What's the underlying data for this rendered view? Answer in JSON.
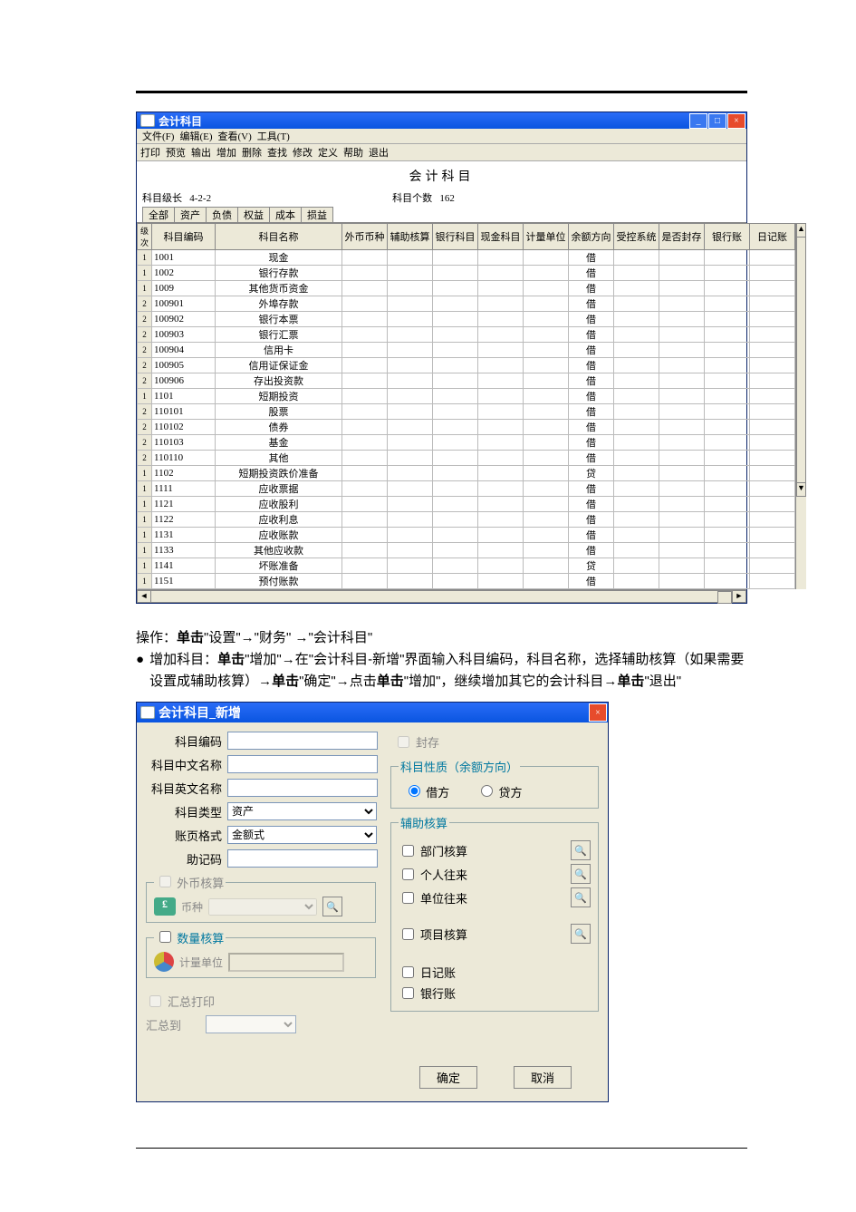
{
  "window1": {
    "title": "会计科目",
    "menus": [
      "文件(F)",
      "编辑(E)",
      "查看(V)",
      "工具(T)"
    ],
    "toolbar": [
      "打印",
      "预览",
      "输出",
      "增加",
      "删除",
      "查找",
      "修改",
      "定义",
      "帮助",
      "退出"
    ],
    "heading": "会计科目",
    "meta": {
      "length_label": "科目级长",
      "length_value": "4-2-2",
      "count_label": "科目个数",
      "count_value": "162"
    },
    "tabs": [
      "全部",
      "资产",
      "负债",
      "权益",
      "成本",
      "损益"
    ],
    "columns": [
      "级次",
      "科目编码",
      "科目名称",
      "外币币种",
      "辅助核算",
      "银行科目",
      "现金科目",
      "计量单位",
      "余额方向",
      "受控系统",
      "是否封存",
      "银行账",
      "日记账"
    ],
    "rows": [
      {
        "lv": "1",
        "code": "1001",
        "name": "现金",
        "dir": "借"
      },
      {
        "lv": "1",
        "code": "1002",
        "name": "银行存款",
        "dir": "借"
      },
      {
        "lv": "1",
        "code": "1009",
        "name": "其他货币资金",
        "dir": "借"
      },
      {
        "lv": "2",
        "code": "100901",
        "name": "外埠存款",
        "dir": "借"
      },
      {
        "lv": "2",
        "code": "100902",
        "name": "银行本票",
        "dir": "借"
      },
      {
        "lv": "2",
        "code": "100903",
        "name": "银行汇票",
        "dir": "借"
      },
      {
        "lv": "2",
        "code": "100904",
        "name": "信用卡",
        "dir": "借"
      },
      {
        "lv": "2",
        "code": "100905",
        "name": "信用证保证金",
        "dir": "借"
      },
      {
        "lv": "2",
        "code": "100906",
        "name": "存出投资款",
        "dir": "借"
      },
      {
        "lv": "1",
        "code": "1101",
        "name": "短期投资",
        "dir": "借"
      },
      {
        "lv": "2",
        "code": "110101",
        "name": "股票",
        "dir": "借"
      },
      {
        "lv": "2",
        "code": "110102",
        "name": "债券",
        "dir": "借"
      },
      {
        "lv": "2",
        "code": "110103",
        "name": "基金",
        "dir": "借"
      },
      {
        "lv": "2",
        "code": "110110",
        "name": "其他",
        "dir": "借"
      },
      {
        "lv": "1",
        "code": "1102",
        "name": "短期投资跌价准备",
        "dir": "贷"
      },
      {
        "lv": "1",
        "code": "1111",
        "name": "应收票据",
        "dir": "借"
      },
      {
        "lv": "1",
        "code": "1121",
        "name": "应收股利",
        "dir": "借"
      },
      {
        "lv": "1",
        "code": "1122",
        "name": "应收利息",
        "dir": "借"
      },
      {
        "lv": "1",
        "code": "1131",
        "name": "应收账款",
        "dir": "借"
      },
      {
        "lv": "1",
        "code": "1133",
        "name": "其他应收款",
        "dir": "借"
      },
      {
        "lv": "1",
        "code": "1141",
        "name": "坏账准备",
        "dir": "贷"
      },
      {
        "lv": "1",
        "code": "1151",
        "name": "预付账款",
        "dir": "借"
      }
    ]
  },
  "instructions": {
    "line1_prefix": "操作：",
    "line1_bold": "单击",
    "line1_rest": "\"设置\"→\"财务\" →\"会计科目\"",
    "bullet_title": "增加科目：",
    "bullet_b1": "单击",
    "bullet_t1": "\"增加\"→在\"会计科目-新增\"界面输入科目编码，科目名称，选择辅助核算（如果需要设置成辅助核算）→",
    "bullet_b2": "单击",
    "bullet_t2": "\"确定\"→点击",
    "bullet_b3": "单击",
    "bullet_t3": "\"增加\"，继续增加其它的会计科目→",
    "bullet_b4": "单击",
    "bullet_t4": "\"退出\""
  },
  "dialog": {
    "title": "会计科目_新增",
    "fields": {
      "code": "科目编码",
      "name_cn": "科目中文名称",
      "name_en": "科目英文名称",
      "type": "科目类型",
      "type_value": "资产",
      "page": "账页格式",
      "page_value": "金额式",
      "mnemonic": "助记码"
    },
    "groups": {
      "fx": "外币核算",
      "fx_currency": "币种",
      "qty": "数量核算",
      "qty_unit": "计量单位",
      "sum": "汇总打印",
      "sum_to": "汇总到",
      "sealed": "封存",
      "nature": "科目性质（余额方向）",
      "debit": "借方",
      "credit": "贷方",
      "aux": "辅助核算",
      "aux_dept": "部门核算",
      "aux_person": "个人往来",
      "aux_unit": "单位往来",
      "aux_project": "项目核算",
      "journal": "日记账",
      "bank": "银行账"
    },
    "buttons": {
      "ok": "确定",
      "cancel": "取消"
    }
  }
}
